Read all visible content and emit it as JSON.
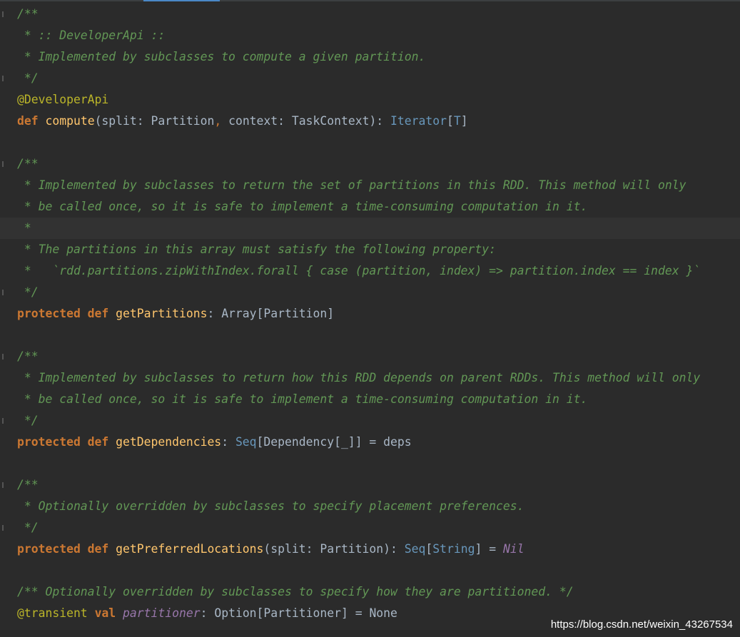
{
  "editor": {
    "colors": {
      "background": "#2b2b2b",
      "current_line": "#323232",
      "doc_comment": "#629755",
      "keyword": "#cc7832",
      "annotation": "#bbb529",
      "function": "#ffc66d",
      "plain": "#a9b7c6",
      "type_param": "#6897bb",
      "field": "#9876aa",
      "tab_indicator": "#4a88c7"
    },
    "lines": [
      {
        "kind": "doc",
        "fold": true,
        "tokens": [
          {
            "c": "doc",
            "t": "/**"
          }
        ]
      },
      {
        "kind": "doc",
        "tokens": [
          {
            "c": "doc",
            "t": " * :: DeveloperApi ::"
          }
        ]
      },
      {
        "kind": "doc",
        "tokens": [
          {
            "c": "doc",
            "t": " * Implemented by subclasses to compute a given partition."
          }
        ]
      },
      {
        "kind": "doc",
        "fold": true,
        "tokens": [
          {
            "c": "doc",
            "t": " */"
          }
        ]
      },
      {
        "kind": "code",
        "tokens": [
          {
            "c": "annot",
            "t": "@DeveloperApi"
          }
        ]
      },
      {
        "kind": "code",
        "tokens": [
          {
            "c": "kw",
            "t": "def "
          },
          {
            "c": "fn",
            "t": "compute"
          },
          {
            "c": "plain",
            "t": "(split: Partition"
          },
          {
            "c": "punct",
            "t": ", "
          },
          {
            "c": "plain",
            "t": "context: TaskContext): "
          },
          {
            "c": "tp",
            "t": "Iterator"
          },
          {
            "c": "plain",
            "t": "["
          },
          {
            "c": "tp",
            "t": "T"
          },
          {
            "c": "plain",
            "t": "]"
          }
        ]
      },
      {
        "kind": "blank",
        "tokens": []
      },
      {
        "kind": "doc",
        "fold": true,
        "tokens": [
          {
            "c": "doc",
            "t": "/**"
          }
        ]
      },
      {
        "kind": "doc",
        "tokens": [
          {
            "c": "doc",
            "t": " * Implemented by subclasses to return the set of partitions in this RDD. This method will only"
          }
        ]
      },
      {
        "kind": "doc",
        "tokens": [
          {
            "c": "doc",
            "t": " * be called once, so it is safe to implement a time-consuming computation in it."
          }
        ]
      },
      {
        "kind": "doc",
        "current": true,
        "tokens": [
          {
            "c": "doc",
            "t": " *"
          }
        ]
      },
      {
        "kind": "doc",
        "tokens": [
          {
            "c": "doc",
            "t": " * The partitions in this array must satisfy the following property:"
          }
        ]
      },
      {
        "kind": "doc",
        "tokens": [
          {
            "c": "doc",
            "t": " *   `rdd.partitions.zipWithIndex.forall { case (partition, index) => partition.index == index }`"
          }
        ]
      },
      {
        "kind": "doc",
        "fold": true,
        "tokens": [
          {
            "c": "doc",
            "t": " */"
          }
        ]
      },
      {
        "kind": "code",
        "tokens": [
          {
            "c": "kw",
            "t": "protected def "
          },
          {
            "c": "fn",
            "t": "getPartitions"
          },
          {
            "c": "plain",
            "t": ": Array[Partition]"
          }
        ]
      },
      {
        "kind": "blank",
        "tokens": []
      },
      {
        "kind": "doc",
        "fold": true,
        "tokens": [
          {
            "c": "doc",
            "t": "/**"
          }
        ]
      },
      {
        "kind": "doc",
        "tokens": [
          {
            "c": "doc",
            "t": " * Implemented by subclasses to return how this RDD depends on parent RDDs. This method will only"
          }
        ]
      },
      {
        "kind": "doc",
        "tokens": [
          {
            "c": "doc",
            "t": " * be called once, so it is safe to implement a time-consuming computation in it."
          }
        ]
      },
      {
        "kind": "doc",
        "fold": true,
        "tokens": [
          {
            "c": "doc",
            "t": " */"
          }
        ]
      },
      {
        "kind": "code",
        "tokens": [
          {
            "c": "kw",
            "t": "protected def "
          },
          {
            "c": "fn",
            "t": "getDependencies"
          },
          {
            "c": "plain",
            "t": ": "
          },
          {
            "c": "tp",
            "t": "Seq"
          },
          {
            "c": "plain",
            "t": "[Dependency[_]] = deps"
          }
        ]
      },
      {
        "kind": "blank",
        "tokens": []
      },
      {
        "kind": "doc",
        "fold": true,
        "tokens": [
          {
            "c": "doc",
            "t": "/**"
          }
        ]
      },
      {
        "kind": "doc",
        "tokens": [
          {
            "c": "doc",
            "t": " * Optionally overridden by subclasses to specify placement preferences."
          }
        ]
      },
      {
        "kind": "doc",
        "fold": true,
        "tokens": [
          {
            "c": "doc",
            "t": " */"
          }
        ]
      },
      {
        "kind": "code",
        "tokens": [
          {
            "c": "kw",
            "t": "protected def "
          },
          {
            "c": "fn",
            "t": "getPreferredLocations"
          },
          {
            "c": "plain",
            "t": "(split: Partition): "
          },
          {
            "c": "tp",
            "t": "Seq"
          },
          {
            "c": "plain",
            "t": "["
          },
          {
            "c": "tp",
            "t": "String"
          },
          {
            "c": "plain",
            "t": "] = "
          },
          {
            "c": "fld",
            "t": "Nil"
          }
        ]
      },
      {
        "kind": "blank",
        "tokens": []
      },
      {
        "kind": "doc",
        "tokens": [
          {
            "c": "doc",
            "t": "/** Optionally overridden by subclasses to specify how they are partitioned. */"
          }
        ]
      },
      {
        "kind": "code",
        "tokens": [
          {
            "c": "annot",
            "t": "@transient "
          },
          {
            "c": "kw",
            "t": "val "
          },
          {
            "c": "fld",
            "t": "partitioner"
          },
          {
            "c": "plain",
            "t": ": Option[Partitioner] = None"
          }
        ]
      }
    ]
  },
  "watermark": "https://blog.csdn.net/weixin_43267534"
}
